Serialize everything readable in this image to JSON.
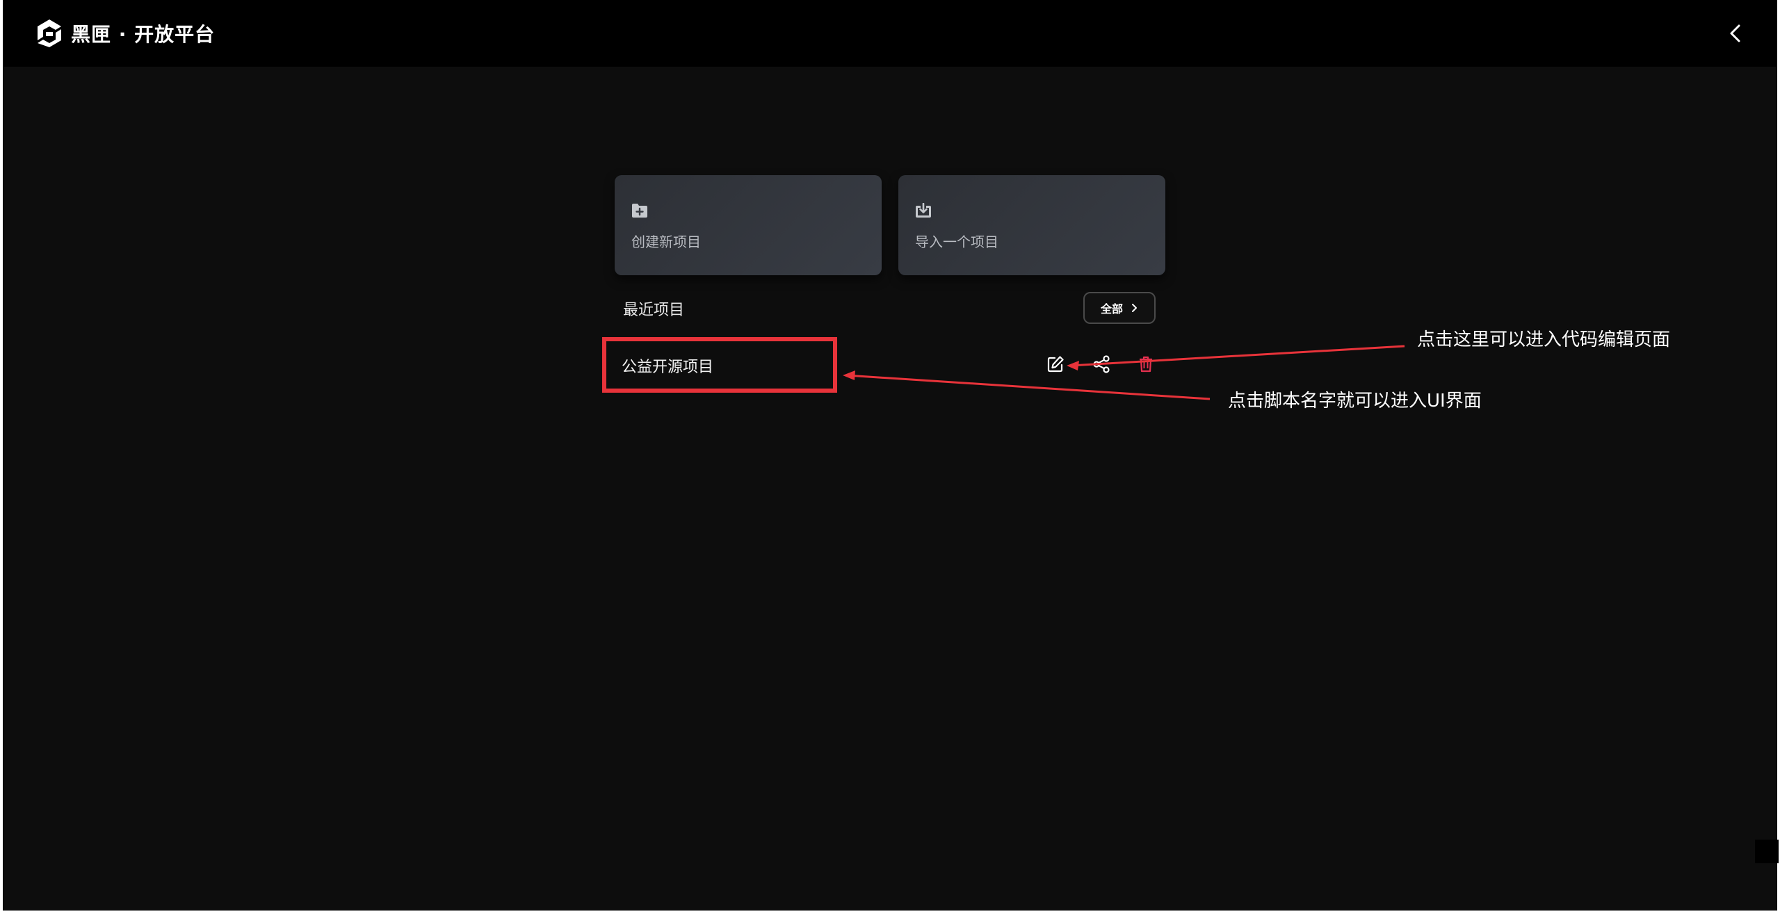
{
  "header": {
    "logo_text": "黑匣 · 开放平台",
    "back_icon": "chevron-left-icon"
  },
  "cards": {
    "create": {
      "label": "创建新项目",
      "icon": "folder-plus-icon"
    },
    "import": {
      "label": "导入一个项目",
      "icon": "download-icon"
    }
  },
  "recent": {
    "title": "最近项目",
    "all_button_label": "全部",
    "projects": [
      {
        "name": "公益开源项目"
      }
    ]
  },
  "project_actions": {
    "edit_icon": "edit-icon",
    "share_icon": "share-icon",
    "delete_icon": "trash-icon"
  },
  "annotations": {
    "edit_hint": "点击这里可以进入代码编辑页面",
    "name_hint": "点击脚本名字就可以进入UI界面"
  },
  "colors": {
    "background": "#0d0d0d",
    "header": "#000000",
    "card": "#353940",
    "highlight": "#e8333a",
    "delete": "#e5314f"
  }
}
